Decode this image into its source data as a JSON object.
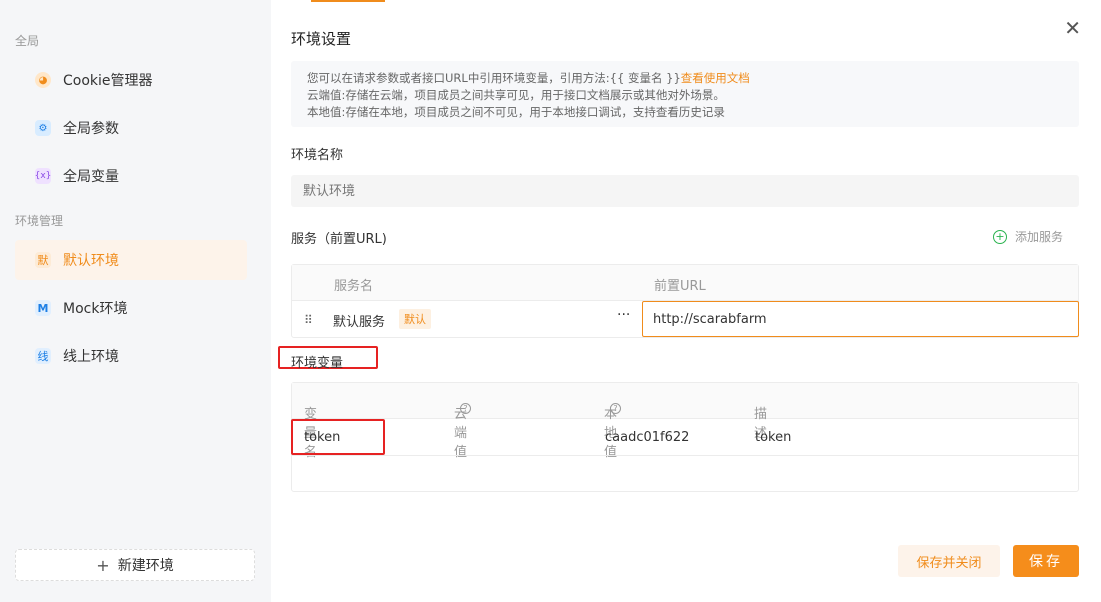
{
  "sidebar": {
    "section_global": "全局",
    "global_items": [
      {
        "label": "Cookie管理器",
        "icon": "cookie-icon"
      },
      {
        "label": "全局参数",
        "icon": "gear-icon"
      },
      {
        "label": "全局变量",
        "icon": "variable-icon"
      }
    ],
    "section_env": "环境管理",
    "env_items": [
      {
        "label": "默认环境",
        "icon_text": "默",
        "active": true
      },
      {
        "label": "Mock环境",
        "icon_text": "M",
        "active": false
      },
      {
        "label": "线上环境",
        "icon_text": "线",
        "active": false
      }
    ],
    "new_env_label": "新建环境"
  },
  "main": {
    "title": "环境设置",
    "close_symbol": "✕",
    "tip": {
      "line1_prefix": "您可以在请求参数或者接口URL中引用环境变量，引用方法:{{ 变量名 }}",
      "line1_link": "查看使用文档",
      "line2": "云端值:存储在云端，项目成员之间共享可见，用于接口文档展示或其他对外场景。",
      "line3": "本地值:存储在本地，项目成员之间不可见，用于本地接口调试，支持查看历史记录"
    },
    "env_name_label": "环境名称",
    "env_name_placeholder": "默认环境",
    "service_label": "服务（前置URL)",
    "add_service_label": "添加服务",
    "service_table": {
      "headers": {
        "name": "服务名",
        "url": "前置URL"
      },
      "rows": [
        {
          "name": "默认服务",
          "badge": "默认",
          "url": "http://scarabfarm"
        }
      ]
    },
    "env_var_label": "环境变量",
    "var_table": {
      "headers": {
        "name": "变量名",
        "cloud": "云端值",
        "local": "本地值",
        "desc": "描述"
      },
      "rows": [
        {
          "name": "token",
          "cloud": "",
          "local": "caadc01f622",
          "desc": "token"
        }
      ]
    },
    "buttons": {
      "save_close": "保存并关闭",
      "save": "保存"
    }
  },
  "colors": {
    "accent": "#f08c1c",
    "highlight_red": "#e62222",
    "add_green": "#2ab34f"
  }
}
